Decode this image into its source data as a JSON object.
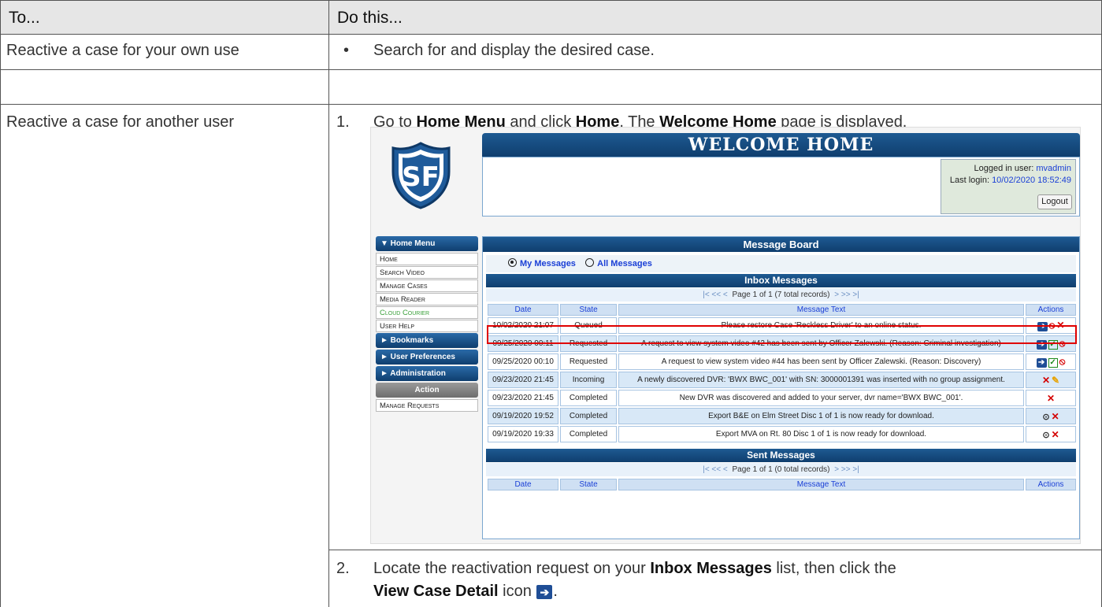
{
  "header": {
    "col1": "To...",
    "col2": "Do this..."
  },
  "rows": [
    {
      "task": "Reactive a case for your own use",
      "bullet": "•",
      "instruction": "Search for and display the desired case."
    },
    {
      "task": "Reactive a case for another user"
    }
  ],
  "step1": {
    "num": "1.",
    "t1": "Go to ",
    "b1": "Home Menu",
    "t2": " and click ",
    "b2": "Home",
    "t3": ". The ",
    "b3": "Welcome Home",
    "t4": " page is displayed."
  },
  "step2": {
    "num": "2.",
    "t1": "Locate the reactivation request on your ",
    "b1": "Inbox Messages",
    "t2": " list, then click the",
    "b2": "View Case Detail",
    "t3": " icon ",
    "t4": "."
  },
  "screenshot": {
    "title": "WELCOME HOME",
    "login_label": "Logged in user: ",
    "login_user": "mvadmin",
    "last_label": "Last login: ",
    "last_value": "10/02/2020 18:52:49",
    "logout": "Logout",
    "menu": {
      "home_menu": "▼ Home Menu",
      "items": [
        "Home",
        "Search Video",
        "Manage Cases",
        "Media Reader",
        "Cloud Courier",
        "User Help"
      ],
      "bookmarks": "► Bookmarks",
      "prefs": "► User Preferences",
      "admin": "► Administration",
      "action": "Action",
      "manage_requests": "Manage Requests"
    },
    "board_title": "Message Board",
    "my_messages": "My Messages",
    "all_messages": "All Messages",
    "inbox_title": "Inbox Messages",
    "inbox_pager": "Page 1 of 1 (7 total records)",
    "sent_title": "Sent Messages",
    "sent_pager": "Page 1 of 1 (0 total records)",
    "pager_left": "|< << <",
    "pager_right": "> >> >|",
    "cols": [
      "Date",
      "State",
      "Message Text",
      "Actions"
    ],
    "messages": [
      {
        "date": "10/02/2020 21:07",
        "state": "Queued",
        "text": "Please restore Case 'Reckless Driver' to an online status.",
        "actions": "➔⦸✕"
      },
      {
        "date": "09/25/2020 00:11",
        "state": "Requested",
        "text": "A request to view system video #42 has been sent by Officer Zalewski. (Reason: Criminal investigation)",
        "actions": "➔✓⦸"
      },
      {
        "date": "09/25/2020 00:10",
        "state": "Requested",
        "text": "A request to view system video #44 has been sent by Officer Zalewski. (Reason: Discovery)",
        "actions": "➔✓⦸"
      },
      {
        "date": "09/23/2020 21:45",
        "state": "Incoming",
        "text": "A newly discovered DVR: 'BWX BWC_001' with SN: 3000001391 was inserted with no group assignment.",
        "actions": "✕✎"
      },
      {
        "date": "09/23/2020 21:45",
        "state": "Completed",
        "text": "New DVR was discovered and added to your server, dvr name='BWX BWC_001'.",
        "actions": "✕"
      },
      {
        "date": "09/19/2020 19:52",
        "state": "Completed",
        "text": "Export B&E on Elm Street Disc 1 of 1 is now ready for download.",
        "actions": "⊙✕"
      },
      {
        "date": "09/19/2020 19:33",
        "state": "Completed",
        "text": "Export MVA on Rt. 80 Disc 1 of 1 is now ready for download.",
        "actions": "⊙✕"
      }
    ]
  }
}
